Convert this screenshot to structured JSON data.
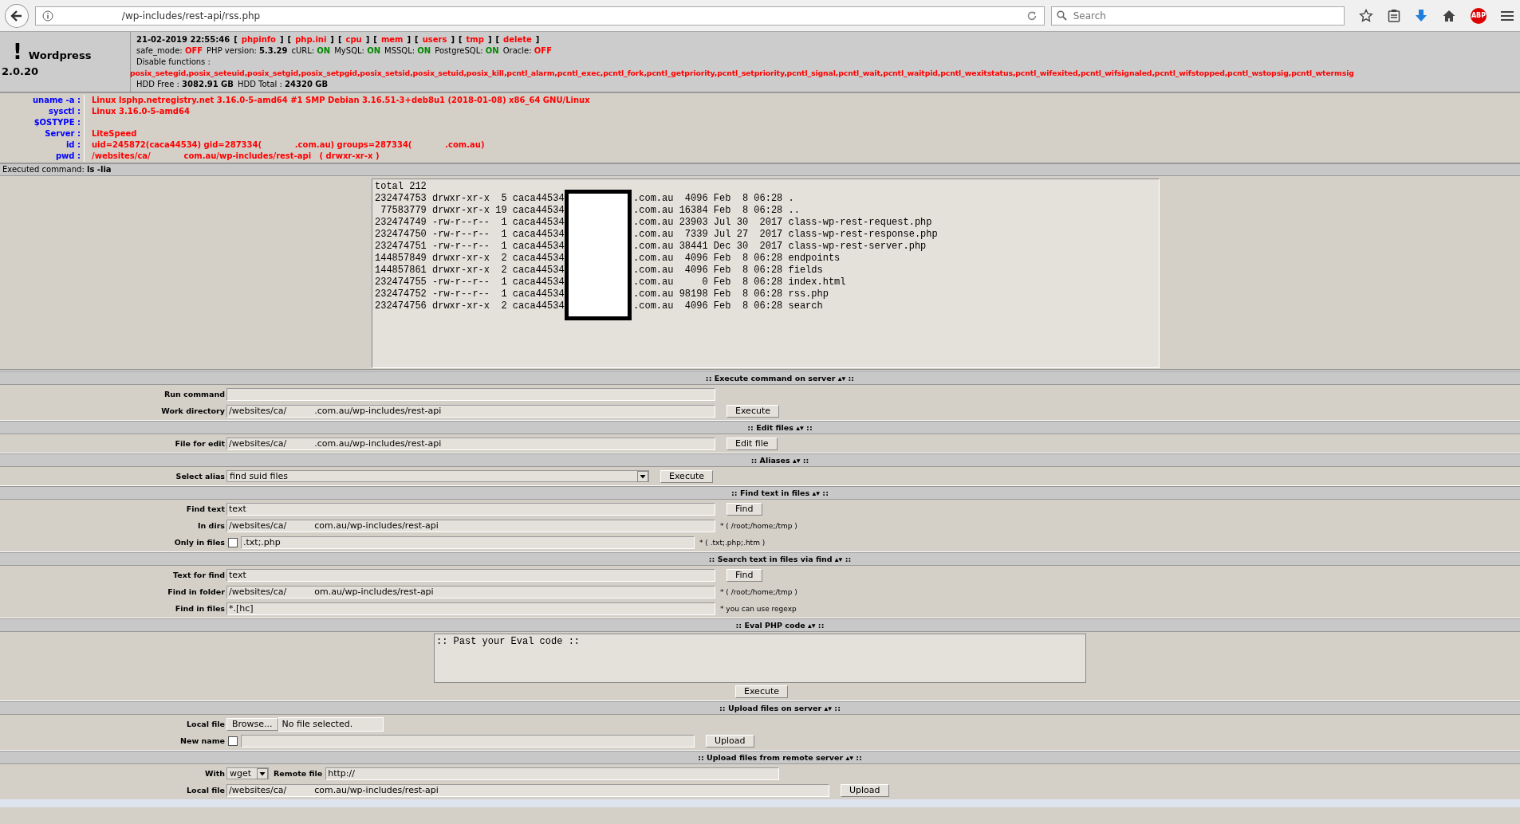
{
  "browser": {
    "url": "/wp-includes/rest-api/rss.php",
    "search_placeholder": "Search",
    "adblock_label": "ABP"
  },
  "header": {
    "mark": "!",
    "name": "Wordpress",
    "version": "2.0.20",
    "datetime": "21-02-2019 22:55:46",
    "links": [
      {
        "open": "[",
        "label": "phpinfo",
        "close": "]"
      },
      {
        "open": "[",
        "label": "php.ini",
        "close": "]"
      },
      {
        "open": "[",
        "label": "cpu",
        "close": "]"
      },
      {
        "open": "[",
        "label": "mem",
        "close": "]"
      },
      {
        "open": "[",
        "label": "users",
        "close": "]"
      },
      {
        "open": "[",
        "label": "tmp",
        "close": "]"
      },
      {
        "open": "[",
        "label": "delete",
        "close": "]"
      }
    ],
    "status": [
      {
        "label": "safe_mode:",
        "value": "OFF",
        "kind": "off"
      },
      {
        "label": "PHP version:",
        "value": "5.3.29",
        "kind": "plain"
      },
      {
        "label": "cURL:",
        "value": "ON",
        "kind": "on"
      },
      {
        "label": "MySQL:",
        "value": "ON",
        "kind": "on"
      },
      {
        "label": "MSSQL:",
        "value": "ON",
        "kind": "on"
      },
      {
        "label": "PostgreSQL:",
        "value": "ON",
        "kind": "on"
      },
      {
        "label": "Oracle:",
        "value": "OFF",
        "kind": "off"
      }
    ],
    "disable_label": "Disable functions :",
    "disable_functions": "posix_setegid,posix_seteuid,posix_setgid,posix_setpgid,posix_setsid,posix_setuid,posix_kill,pcntl_alarm,pcntl_exec,pcntl_fork,pcntl_getpriority,pcntl_setpriority,pcntl_signal,pcntl_wait,pcntl_waitpid,pcntl_wexitstatus,pcntl_wifexited,pcntl_wifsignaled,pcntl_wifstopped,pcntl_wstopsig,pcntl_wtermsig",
    "hdd": [
      {
        "label": "HDD Free :",
        "value": "3082.91 GB"
      },
      {
        "label": "HDD Total :",
        "value": "24320 GB"
      }
    ]
  },
  "info": [
    {
      "label": "uname -a :",
      "value": "Linux lsphp.netregistry.net 3.16.0-5-amd64 #1 SMP Debian 3.16.51-3+deb8u1 (2018-01-08) x86_64 GNU/Linux"
    },
    {
      "label": "sysctl :",
      "value": "Linux 3.16.0-5-amd64"
    },
    {
      "label": "$OSTYPE :"
    },
    {
      "label": "Server :",
      "value": "LiteSpeed"
    },
    {
      "label": "id :",
      "value": "uid=245872(caca44534) gid=287334(            .com.au) groups=287334(            .com.au)"
    },
    {
      "label": "pwd :",
      "value": "/websites/ca/            com.au/wp-includes/rest-api   ( drwxr-xr-x )"
    }
  ],
  "executed": {
    "label": "Executed command:",
    "command": "ls -lia"
  },
  "listing": [
    "total 212",
    "232474753 drwxr-xr-x  5 caca44534            .com.au  4096 Feb  8 06:28 .",
    " 77583779 drwxr-xr-x 19 caca44534            .com.au 16384 Feb  8 06:28 ..",
    "232474749 -rw-r--r--  1 caca44534            .com.au 23903 Jul 30  2017 class-wp-rest-request.php",
    "232474750 -rw-r--r--  1 caca44534            .com.au  7339 Jul 27  2017 class-wp-rest-response.php",
    "232474751 -rw-r--r--  1 caca44534            .com.au 38441 Dec 30  2017 class-wp-rest-server.php",
    "144857849 drwxr-xr-x  2 caca44534            .com.au  4096 Feb  8 06:28 endpoints",
    "144857861 drwxr-xr-x  2 caca44534            .com.au  4096 Feb  8 06:28 fields",
    "232474755 -rw-r--r--  1 caca44534            .com.au     0 Feb  8 06:28 index.html",
    "232474752 -rw-r--r--  1 caca44534            .com.au 98198 Feb  8 06:28 rss.php",
    "232474756 drwxr-xr-x  2 caca44534            .com.au  4096 Feb  8 06:28 search"
  ],
  "sections": [
    {
      "title": ":: Execute command on server ▴▾ ::",
      "rows": [
        {
          "label": "Run command",
          "fields": [
            {
              "kind": "text"
            }
          ]
        },
        {
          "label": "Work directory",
          "fields": [
            {
              "kind": "text",
              "value": "/websites/ca/          .com.au/wp-includes/rest-api"
            },
            {
              "kind": "button",
              "label": "Execute"
            }
          ]
        }
      ]
    },
    {
      "title": ":: Edit files ▴▾ ::",
      "rows": [
        {
          "label": "File for edit",
          "fields": [
            {
              "kind": "text",
              "value": "/websites/ca/          .com.au/wp-includes/rest-api"
            },
            {
              "kind": "button",
              "label": "Edit file"
            }
          ]
        }
      ]
    },
    {
      "title": ":: Aliases ▴▾ ::",
      "rows": [
        {
          "label": "Select alias",
          "fields": [
            {
              "kind": "select",
              "value": "find suid files"
            },
            {
              "kind": "button",
              "label": "Execute"
            }
          ]
        }
      ]
    },
    {
      "title": ":: Find text in files ▴▾ ::",
      "rows": [
        {
          "label": "Find text",
          "fields": [
            {
              "kind": "text",
              "value": "text"
            },
            {
              "kind": "button",
              "label": "Find"
            }
          ]
        },
        {
          "label": "In dirs",
          "fields": [
            {
              "kind": "text",
              "value": "/websites/ca/          com.au/wp-includes/rest-api"
            },
            {
              "kind": "note",
              "text": "* ( /root;/home;/tmp )"
            }
          ]
        },
        {
          "label": "Only in files",
          "fields": [
            {
              "kind": "checkbox",
              "checked": false
            },
            {
              "kind": "text",
              "value": ".txt;.php"
            },
            {
              "kind": "note",
              "text": "* ( .txt;.php;.htm )"
            }
          ]
        }
      ]
    },
    {
      "title": ":: Search text in files via find ▴▾ ::",
      "rows": [
        {
          "label": "Text for find",
          "fields": [
            {
              "kind": "text",
              "value": "text"
            },
            {
              "kind": "button",
              "label": "Find"
            }
          ]
        },
        {
          "label": "Find in folder",
          "fields": [
            {
              "kind": "text",
              "value": "/websites/ca/          om.au/wp-includes/rest-api"
            },
            {
              "kind": "note",
              "text": "* ( /root;/home;/tmp )"
            }
          ]
        },
        {
          "label": "Find in files",
          "fields": [
            {
              "kind": "text",
              "value": "*.[hc]"
            },
            {
              "kind": "note",
              "text": "* you can use regexp"
            }
          ]
        }
      ]
    },
    {
      "title": ":: Eval PHP code ▴▾ ::",
      "rows": [
        {
          "kind": "eval",
          "value": ":: Past your Eval code ::",
          "button": "Execute"
        }
      ]
    },
    {
      "title": ":: Upload files on server ▴▾ ::",
      "rows": [
        {
          "label": "Local file",
          "fields": [
            {
              "kind": "file",
              "button": "Browse...",
              "status": "No file selected."
            }
          ]
        },
        {
          "label": "New name",
          "fields": [
            {
              "kind": "checkbox",
              "checked": false
            },
            {
              "kind": "text"
            },
            {
              "kind": "button",
              "label": "Upload"
            }
          ]
        }
      ]
    },
    {
      "title": ":: Upload files from remote server ▴▾ ::",
      "rows": [
        {
          "label": "With",
          "fields": [
            {
              "kind": "select",
              "value": "wget"
            },
            {
              "kind": "label",
              "text": "Remote file"
            },
            {
              "kind": "text",
              "value": "http://"
            }
          ]
        },
        {
          "label": "Local file",
          "fields": [
            {
              "kind": "long-text",
              "value": "/websites/ca/          com.au/wp-includes/rest-api"
            },
            {
              "kind": "button",
              "label": "Upload"
            }
          ]
        }
      ]
    }
  ]
}
